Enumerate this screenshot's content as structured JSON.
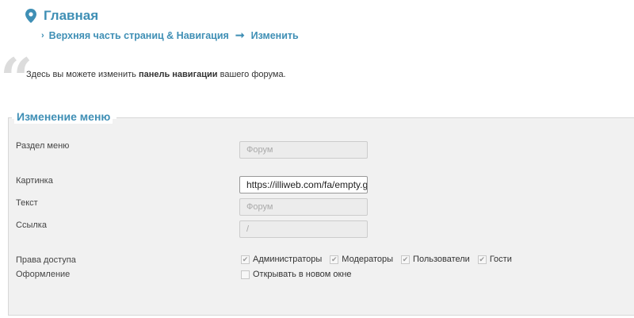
{
  "header": {
    "title": "Главная",
    "icon": "map-pin-icon",
    "accent": "#3f8fb5"
  },
  "breadcrumb": {
    "section": "Верхняя часть страниц & Навигация",
    "page": "Изменить"
  },
  "intro": {
    "prefix": "Здесь вы можете изменить ",
    "bold": "панель навигации",
    "suffix": " вашего форума."
  },
  "form": {
    "legend": "Изменение меню",
    "fields": {
      "section_label": "Раздел меню",
      "section_value": "Форум",
      "image_label": "Картинка",
      "image_value": "https://illiweb.com/fa/empty.g",
      "text_label": "Текст",
      "text_value": "Форум",
      "link_label": "Ссылка",
      "link_value": "/"
    },
    "access": {
      "label": "Права доступа",
      "options": [
        {
          "label": "Администраторы",
          "checked": true
        },
        {
          "label": "Модераторы",
          "checked": true
        },
        {
          "label": "Пользователи",
          "checked": true
        },
        {
          "label": "Гости",
          "checked": true
        }
      ]
    },
    "design": {
      "label": "Оформление",
      "new_window_label": "Открывать в новом окне",
      "new_window_checked": false
    }
  }
}
